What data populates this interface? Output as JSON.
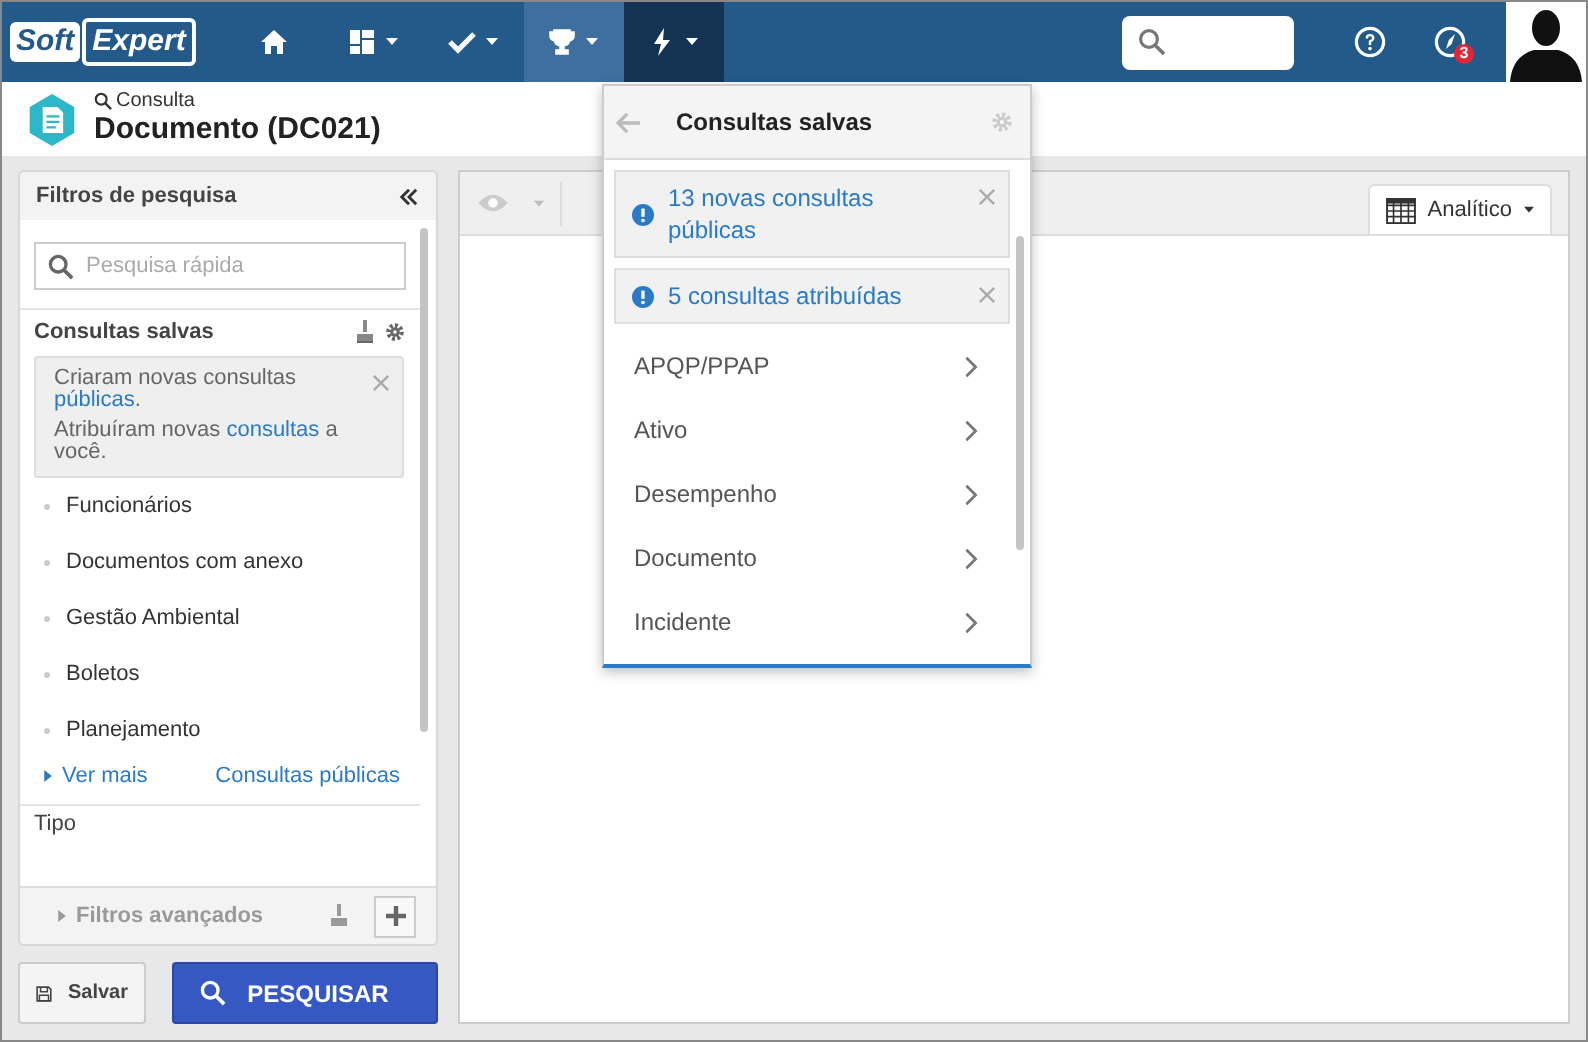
{
  "topbar": {
    "logo": [
      "Soft",
      "Expert"
    ],
    "nav": [
      {
        "kind": "home",
        "caret": false,
        "hovered": false,
        "selected": false
      },
      {
        "kind": "dashboard",
        "caret": true,
        "hovered": false,
        "selected": false
      },
      {
        "kind": "check",
        "caret": true,
        "hovered": false,
        "selected": false
      },
      {
        "kind": "trophy",
        "caret": true,
        "hovered": true,
        "selected": false
      },
      {
        "kind": "bolt",
        "caret": true,
        "hovered": false,
        "selected": true
      }
    ],
    "notification_count": "3"
  },
  "header": {
    "breadcrumb": "Consulta",
    "title": "Documento (DC021)"
  },
  "filters": {
    "title": "Filtros de pesquisa",
    "search": {
      "placeholder": "Pesquisa rápida"
    },
    "saved_title": "Consultas salvas",
    "notice": [
      [
        {
          "text": "Criaram novas consultas ",
          "link": false
        },
        {
          "text": "públicas",
          "link": true
        },
        {
          "text": ".",
          "link": false
        }
      ],
      [
        {
          "text": "Atribuíram novas ",
          "link": false
        },
        {
          "text": "consultas",
          "link": true
        },
        {
          "text": " a você.",
          "link": false
        }
      ]
    ],
    "saved_items": [
      "Funcionários",
      "Documentos com anexo",
      "Gestão Ambiental",
      "Boletos",
      "Planejamento"
    ],
    "see_more": "Ver mais",
    "public_link": "Consultas públicas",
    "section": "Tipo",
    "advanced": "Filtros avançados"
  },
  "actions": {
    "save": "Salvar",
    "search": "PESQUISAR"
  },
  "view": {
    "mode": "Analítico"
  },
  "dropdown": {
    "title": "Consultas salvas",
    "alerts": [
      "13 novas consultas públicas",
      "5 consultas atribuídas"
    ],
    "categories": [
      "APQP/PPAP",
      "Ativo",
      "Desempenho",
      "Documento",
      "Incidente"
    ]
  }
}
